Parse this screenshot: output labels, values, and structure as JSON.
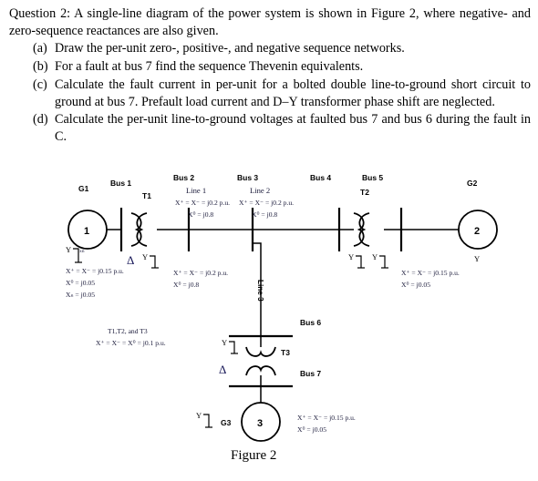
{
  "question": {
    "stem": "Question 2: A single-line diagram of the power system is shown in Figure 2, where negative- and zero-sequence reactances are also given.",
    "items": [
      {
        "marker": "(a)",
        "text": "Draw the per-unit zero-, positive-, and negative sequence networks."
      },
      {
        "marker": "(b)",
        "text": "For a fault at bus 7 find the sequence Thevenin equivalents."
      },
      {
        "marker": "(c)",
        "text": "Calculate the fault current in per-unit for a bolted double line-to-ground short circuit to ground at bus 7. Prefault load current and D–Y transformer phase shift are neglected."
      },
      {
        "marker": "(d)",
        "text": "Calculate the per-unit line-to-ground voltages at faulted bus 7 and bus 6 during the fault in C."
      }
    ]
  },
  "figure": {
    "caption": "Figure 2",
    "buses": {
      "bus1": "Bus 1",
      "bus2": "Bus 2",
      "bus3": "Bus 3",
      "bus4": "Bus 4",
      "bus5": "Bus 5",
      "bus6": "Bus 6",
      "bus7": "Bus 7"
    },
    "generators": {
      "g1_label": "G1",
      "g1_number": "1",
      "g1_winding": "Y",
      "g1_neutral": "xn",
      "g2_label": "G2",
      "g2_number": "2",
      "g2_winding": "Y",
      "g3_label": "G3",
      "g3_number": "3",
      "g3_winding": "Y"
    },
    "transformers": {
      "t1_label": "T1",
      "t1_left_winding": "Δ",
      "t1_right_winding": "Y",
      "t2_label": "T2",
      "t2_left_winding": "Y",
      "t2_right_winding": "Y",
      "t3_label": "T3",
      "t3_top_winding": "Y",
      "t3_bottom_winding": "Δ"
    },
    "lines": {
      "line1_label": "Line 1",
      "line2_label": "Line 2",
      "line3_label": "Line 3"
    },
    "params": {
      "g1": {
        "pos_neg": "X⁺ = X⁻ = j0.15  p.u.",
        "zero": "X⁰ = j0.05",
        "neutral": "Xₙ = j0.05"
      },
      "g2": {
        "pos_neg": "X⁺ = X⁻ = j0.15  p.u.",
        "zero": "X⁰ = j0.05"
      },
      "g3": {
        "pos_neg": "X⁺ = X⁻ = j0.15  p.u.",
        "zero": "X⁰ = j0.05"
      },
      "line1": {
        "pos_neg": "X⁺ = X⁻ = j0.2  p.u.",
        "zero": "X⁰ = j0.8"
      },
      "line2": {
        "pos_neg": "X⁺ = X⁻ = j0.2  p.u.",
        "zero": "X⁰ = j0.8"
      },
      "line3": {
        "pos_neg": "X⁺ = X⁻ = j0.2  p.u.",
        "zero": "X⁰ = j0.8"
      },
      "transformers": {
        "title": "T1,T2, and T3",
        "value": "X⁺ = X⁻ = X⁰ = j0.1  p.u."
      }
    }
  }
}
